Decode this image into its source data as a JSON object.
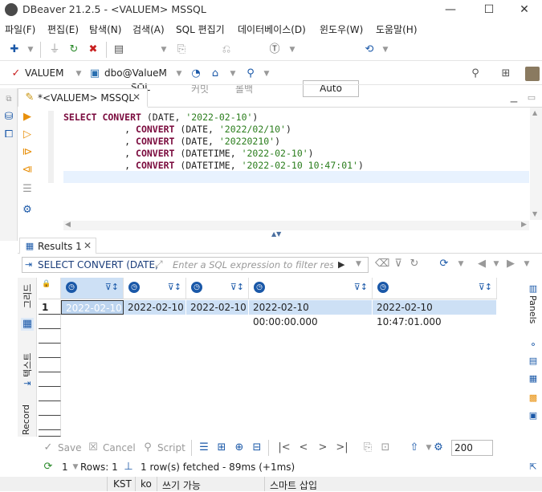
{
  "window": {
    "title": "DBeaver 21.2.5 - <VALUEM> MSSQL",
    "min": "—",
    "max": "☐",
    "close": "✕"
  },
  "menu": [
    "파일(F)",
    "편집(E)",
    "탐색(N)",
    "검색(A)",
    "SQL 편집기",
    "데이터베이스(D)",
    "윈도우(W)",
    "도움말(H)"
  ],
  "toolbar": {
    "sql_label": "SQL",
    "commit_label": "커밋",
    "rollback_label": "롤백",
    "auto_label": "Auto"
  },
  "toolbar2": {
    "connection": "VALUEM",
    "schema": "dbo@ValueM"
  },
  "editor": {
    "tab_label": "*<VALUEM> MSSQL",
    "lines": [
      {
        "kw": "SELECT CONVERT",
        "rest": " (DATE, ",
        "str": "'2022-02-10'",
        "end": ")"
      },
      {
        "kw": "CONVERT",
        "rest": " (DATE, ",
        "str": "'2022/02/10'",
        "end": ")"
      },
      {
        "kw": "CONVERT",
        "rest": " (DATE, ",
        "str": "'20220210'",
        "end": ")"
      },
      {
        "kw": "CONVERT",
        "rest": " (DATETIME, ",
        "str": "'2022-02-10'",
        "end": ")"
      },
      {
        "kw": "CONVERT",
        "rest": " (DATETIME, ",
        "str": "'2022-02-10 10:47:01'",
        "end": ")"
      }
    ]
  },
  "results": {
    "tab_label": "Results 1",
    "filter_query": "SELECT CONVERT (DATE,",
    "filter_placeholder": "Enter a SQL expression to filter results",
    "row_number": "1",
    "cells": [
      "2022-02-10",
      "2022-02-10",
      "2022-02-10",
      "2022-02-10 00:00:00.000",
      "2022-02-10 10:47:01.000"
    ],
    "vtabs": {
      "grid": "그리드",
      "text": "텍스트",
      "record": "Record"
    },
    "panels_label": "Panels"
  },
  "bottom": {
    "save": "Save",
    "cancel": "Cancel",
    "script": "Script",
    "page_size": "200"
  },
  "status": {
    "refresh_count": "1",
    "rows": "Rows: 1",
    "fetched": "1 row(s) fetched - 89ms (+1ms)"
  },
  "footer": {
    "timezone": "KST",
    "locale": "ko",
    "mode": "쓰기 가능",
    "insert": "스마트 삽입"
  }
}
